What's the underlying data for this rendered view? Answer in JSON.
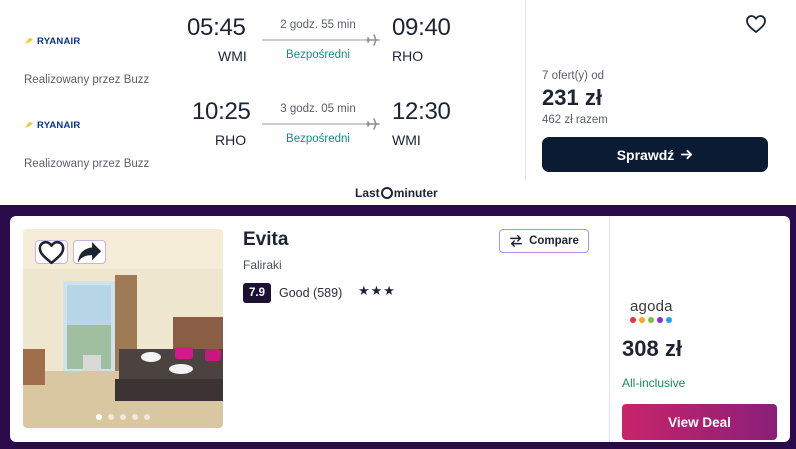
{
  "flight": {
    "legs": [
      {
        "airline": "RYANAIR",
        "operated_by": "Realizowany przez Buzz",
        "departure_time": "05:45",
        "departure_code": "WMI",
        "duration": "2 godz. 55 min",
        "stops": "Bezpośredni",
        "arrival_time": "09:40",
        "arrival_code": "RHO"
      },
      {
        "airline": "RYANAIR",
        "operated_by": "Realizowany przez Buzz",
        "departure_time": "10:25",
        "departure_code": "RHO",
        "duration": "3 godz. 05 min",
        "stops": "Bezpośredni",
        "arrival_time": "12:30",
        "arrival_code": "WMI"
      }
    ],
    "offers_label": "7 ofert(y) od",
    "price": "231 zł",
    "total": "462 zł razem",
    "check_button": "Sprawdź",
    "provider_logo_text": "Last minute",
    "icons": {
      "favorite": "heart-icon",
      "arrow": "arrow-right-icon",
      "plane": "plane-icon"
    }
  },
  "hotel": {
    "name": "Evita",
    "location": "Faliraki",
    "rating_score": "7.9",
    "rating_text": "Good (589)",
    "stars": "★★★",
    "compare_label": "Compare",
    "provider": "agoda",
    "price": "308 zł",
    "board": "All-inclusive",
    "deal_button": "View Deal",
    "photo_count": 5,
    "photo_active_index": 0,
    "colors": {
      "section_bg": "#2b0a4a",
      "deal_start": "#c8246a",
      "deal_end": "#8a1f78",
      "rating_bg": "#1c1130",
      "board_color": "#1a8a5c"
    }
  }
}
